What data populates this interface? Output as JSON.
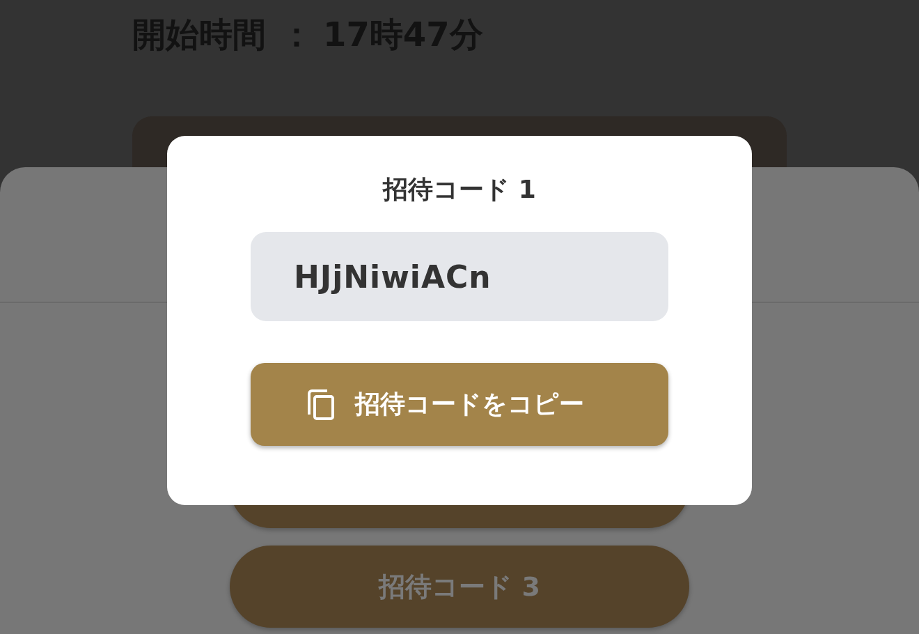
{
  "event_info": [
    {
      "label": "開始時間",
      "separator": "：",
      "value": "17時47分"
    }
  ],
  "sheet": {
    "buttons": [
      {
        "label": "招待コード 3"
      }
    ]
  },
  "dialog": {
    "title": "招待コード 1",
    "code": "HJjNiwiACn",
    "copy_button": {
      "label": "招待コードをコピー"
    }
  }
}
